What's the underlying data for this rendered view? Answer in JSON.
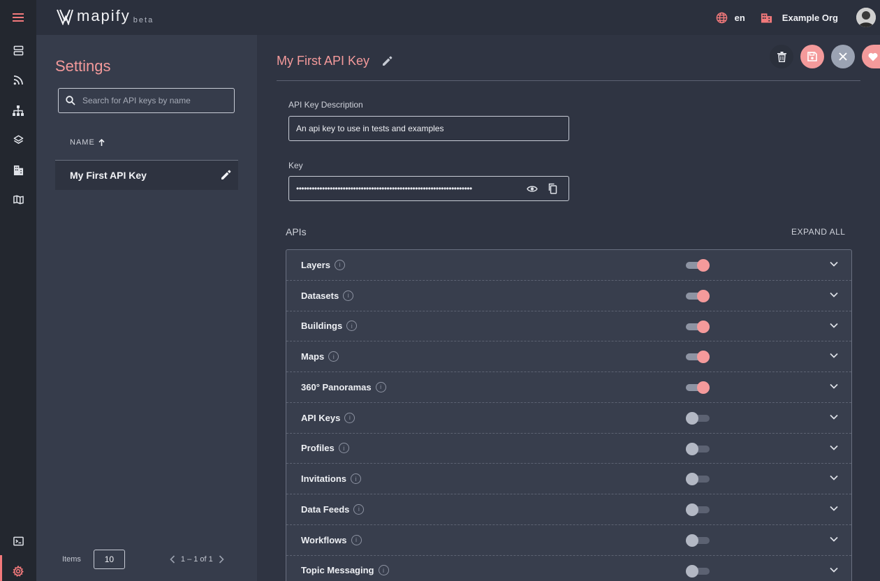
{
  "app": {
    "logo_text": "mapify",
    "logo_badge": "beta"
  },
  "topbar": {
    "language": "en",
    "org_name": "Example Org"
  },
  "rail": {
    "items": [
      "menu-icon",
      "servers-icon",
      "rss-feed-icon",
      "hierarchy-icon",
      "layers-icon",
      "buildings-icon",
      "map-icon",
      "terminal-icon",
      "settings-icon"
    ]
  },
  "settings": {
    "title": "Settings",
    "search_placeholder": "Search for API keys by name",
    "column_name": "NAME",
    "rows": [
      {
        "name": "My First API Key"
      }
    ],
    "pager": {
      "items_label": "Items",
      "page_size": "10",
      "range": "1 – 1 of 1"
    }
  },
  "editor": {
    "title": "My First API Key",
    "description_label": "API Key Description",
    "description_value": "An api key to use in tests and examples",
    "key_label": "Key",
    "key_masked": "••••••••••••••••••••••••••••••••••••••••••••••••••••••••••••••••••••",
    "apis_label": "APIs",
    "expand_all": "EXPAND ALL",
    "apis": [
      {
        "name": "Layers",
        "enabled": true
      },
      {
        "name": "Datasets",
        "enabled": true
      },
      {
        "name": "Buildings",
        "enabled": true
      },
      {
        "name": "Maps",
        "enabled": true
      },
      {
        "name": "360° Panoramas",
        "enabled": true
      },
      {
        "name": "API Keys",
        "enabled": false
      },
      {
        "name": "Profiles",
        "enabled": false
      },
      {
        "name": "Invitations",
        "enabled": false
      },
      {
        "name": "Data Feeds",
        "enabled": false
      },
      {
        "name": "Workflows",
        "enabled": false
      },
      {
        "name": "Topic Messaging",
        "enabled": false
      }
    ]
  },
  "colors": {
    "accent": "#f49a9b",
    "rail_bg": "#23272f",
    "panel_bg": "#363c4b",
    "main_bg": "#2f3442"
  }
}
